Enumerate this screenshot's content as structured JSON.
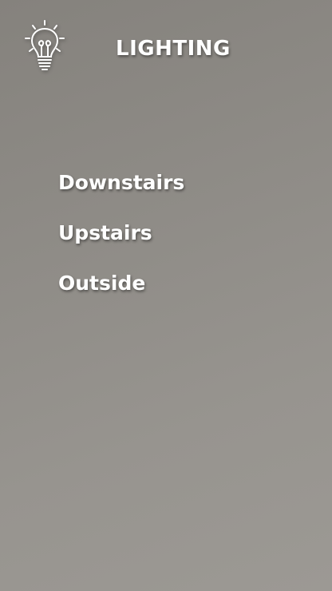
{
  "header": {
    "title": "LIGHTING",
    "icon": "lightbulb-icon"
  },
  "menu": {
    "items": [
      {
        "label": "Downstairs"
      },
      {
        "label": "Upstairs"
      },
      {
        "label": "Outside"
      }
    ]
  },
  "colors": {
    "background_top": "#85827d",
    "background_bottom": "#9c9994",
    "text": "#ffffff"
  }
}
